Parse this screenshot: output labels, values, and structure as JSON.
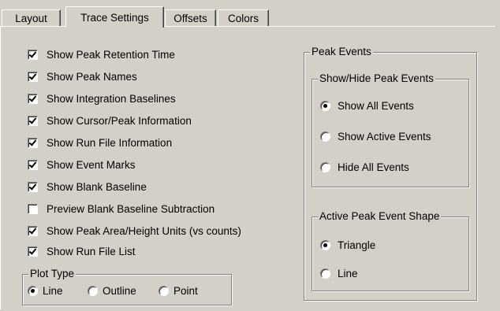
{
  "tabs": [
    "Layout",
    "Trace Settings",
    "Offsets",
    "Colors"
  ],
  "active_tab": "Trace Settings",
  "checkboxes": [
    {
      "label": "Show Peak Retention Time",
      "checked": true
    },
    {
      "label": "Show Peak Names",
      "checked": true
    },
    {
      "label": "Show Integration Baselines",
      "checked": true
    },
    {
      "label": "Show Cursor/Peak Information",
      "checked": true
    },
    {
      "label": "Show Run File Information",
      "checked": true
    },
    {
      "label": "Show Event Marks",
      "checked": true
    },
    {
      "label": "Show Blank Baseline",
      "checked": true
    },
    {
      "label": "Preview Blank Baseline Subtraction",
      "checked": false
    },
    {
      "label": "Show Peak Area/Height Units (vs counts)",
      "checked": true
    },
    {
      "label": "Show Run File List",
      "checked": true
    }
  ],
  "plot_type": {
    "label": "Plot Type",
    "options": [
      "Line",
      "Outline",
      "Point"
    ],
    "selected": "Line"
  },
  "peak_events": {
    "label": "Peak Events",
    "show_hide": {
      "label": "Show/Hide Peak Events",
      "options": [
        "Show All Events",
        "Show Active Events",
        "Hide All Events"
      ],
      "selected": "Show All Events"
    },
    "shape": {
      "label": "Active Peak Event Shape",
      "options": [
        "Triangle",
        "Line"
      ],
      "selected": "Triangle"
    }
  }
}
